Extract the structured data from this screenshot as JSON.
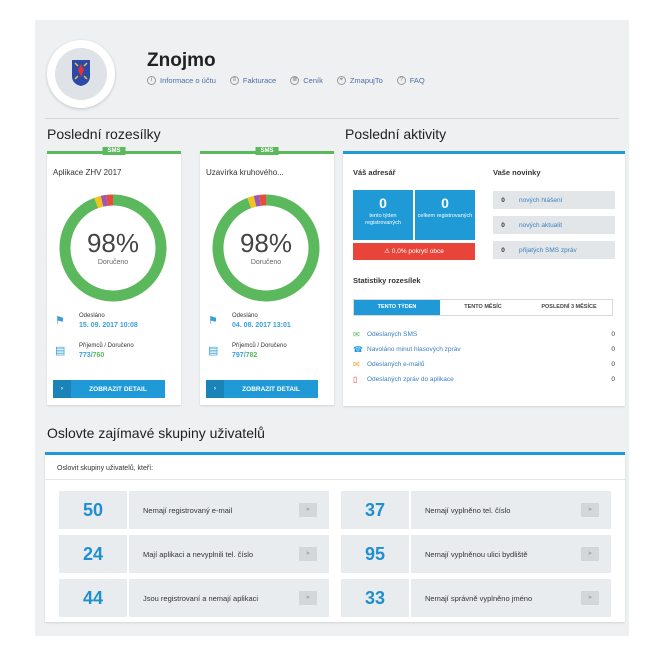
{
  "header": {
    "town": "Znojmo",
    "nav": [
      {
        "label": "Informace o účtu",
        "icon": "i"
      },
      {
        "label": "Fakturace",
        "icon": "≡"
      },
      {
        "label": "Ceník",
        "icon": "≣"
      },
      {
        "label": "ZmapujTo",
        "icon": "⌖"
      },
      {
        "label": "FAQ",
        "icon": "?"
      }
    ]
  },
  "mailings": {
    "title": "Poslední rozesílky",
    "cards": [
      {
        "tag": "SMS",
        "title": "Aplikace ZHV 2017",
        "percent": "98%",
        "percent_label": "Doručeno",
        "sent_label": "Odesláno",
        "sent_value": "15. 09. 2017 10:08",
        "recipients_label": "Příjemců / Doručeno",
        "recipients_total": "773",
        "recipients_delivered": "760",
        "button": "ZOBRAZIT DETAIL"
      },
      {
        "tag": "SMS",
        "title": "Uzavírka kruhového...",
        "percent": "98%",
        "percent_label": "Doručeno",
        "sent_label": "Odesláno",
        "sent_value": "04. 08. 2017 13:01",
        "recipients_label": "Příjemců / Doručeno",
        "recipients_total": "797",
        "recipients_delivered": "782",
        "button": "ZOBRAZIT DETAIL"
      }
    ]
  },
  "activity": {
    "title": "Poslední aktivity",
    "address_label": "Váš adresář",
    "week_value": "0",
    "week_label": "tento týden registrovaných",
    "total_value": "0",
    "total_label": "celkem registrovaných",
    "coverage": "⚠ 0,0% pokrytí obce",
    "news_label": "Vaše novinky",
    "news": [
      {
        "count": "0",
        "label": "nových hlášení"
      },
      {
        "count": "0",
        "label": "nových aktualit"
      },
      {
        "count": "0",
        "label": "přijatých SMS zpráv"
      }
    ],
    "stats_label": "Statistiky rozesílek",
    "tabs": [
      "TENTO TÝDEN",
      "TENTO MĚSÍC",
      "POSLEDNÍ 3 MĚSÍCE"
    ],
    "stats": [
      {
        "label": "Odeslaných SMS",
        "value": "0",
        "icon": "✉"
      },
      {
        "label": "Navoláno minut hlasových zpráv",
        "value": "0",
        "icon": "☎"
      },
      {
        "label": "Odeslaných e-mailů",
        "value": "0",
        "icon": "✉"
      },
      {
        "label": "Odeslaných zpráv do aplikace",
        "value": "0",
        "icon": "▯"
      }
    ]
  },
  "groups": {
    "title": "Oslovte zajímavé skupiny uživatelů",
    "subtitle": "Oslovit skupiny uživatelů, kteří:",
    "items": [
      {
        "count": "50",
        "label": "Nemají registrovaný e-mail"
      },
      {
        "count": "37",
        "label": "Nemají vyplněno tel. číslo"
      },
      {
        "count": "24",
        "label": "Mají aplikaci a nevyplnili tel. číslo"
      },
      {
        "count": "95",
        "label": "Nemají vyplněnou ulici bydliště"
      },
      {
        "count": "44",
        "label": "Jsou registrovaní a nemají aplikaci"
      },
      {
        "count": "33",
        "label": "Nemají správně vyplněno jméno"
      }
    ]
  },
  "colors": {
    "accent": "#1f9ad6",
    "success": "#5cb85c",
    "danger": "#e8443a"
  }
}
